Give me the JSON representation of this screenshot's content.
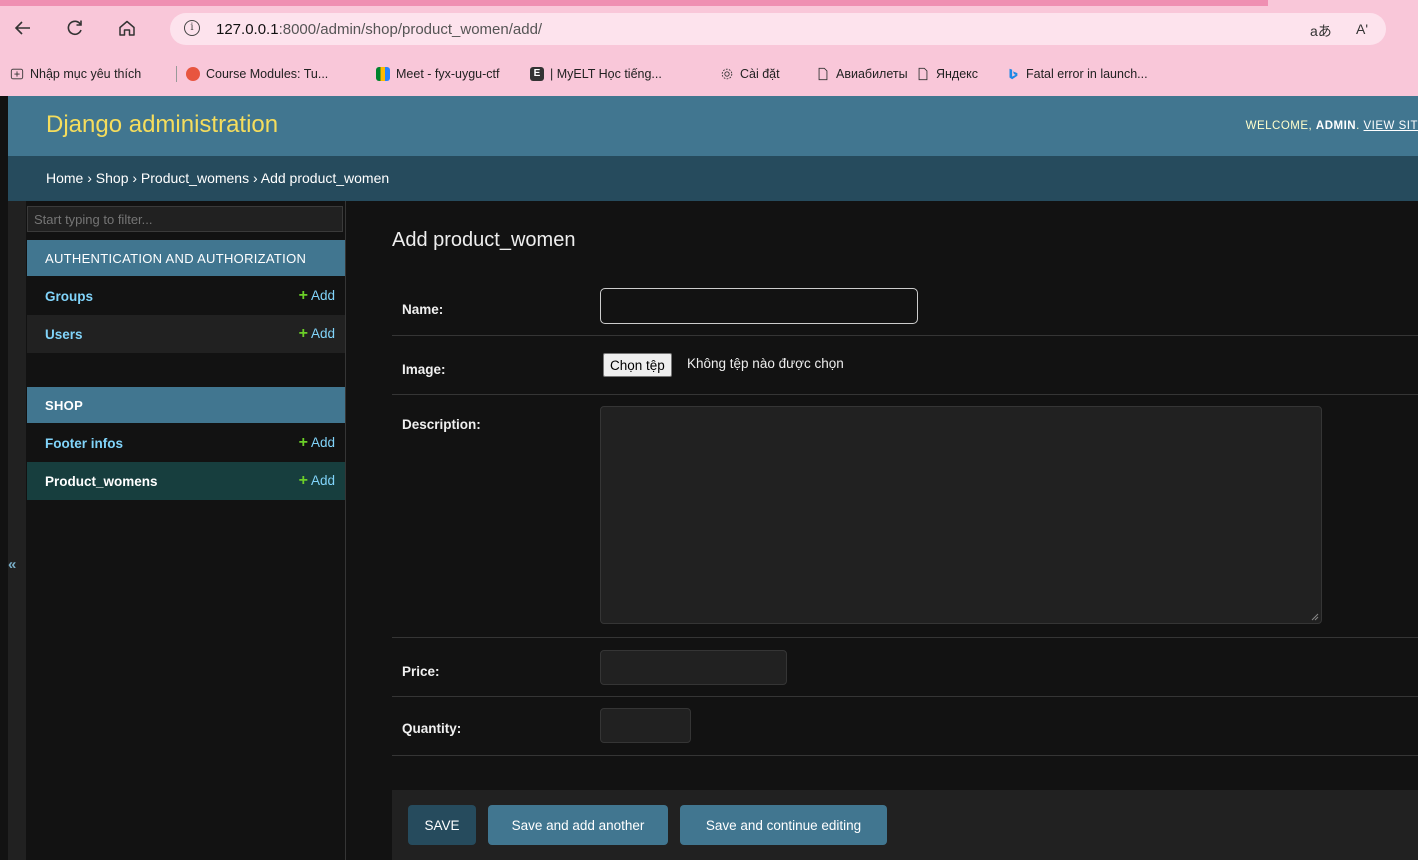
{
  "browser": {
    "address": {
      "host": "127.0.0.1",
      "path": ":8000/admin/shop/product_women/add/"
    },
    "right_icons": [
      "read-aloud-icon",
      "translate-icon"
    ],
    "right_text": {
      "translate": "aあ",
      "read_aloud": "Aʹ"
    },
    "bookmarks": [
      {
        "label": "Nhập mục yêu thích",
        "icon": "bookmark-import-icon"
      },
      {
        "label": "Course Modules: Tu...",
        "icon": "course-modules-icon"
      },
      {
        "label": "Meet - fyx-uygu-ctf",
        "icon": "google-meet-icon"
      },
      {
        "label": "| MyELT Học tiếng...",
        "icon": "myelt-icon"
      },
      {
        "label": "Cài đặt",
        "icon": "settings-gear-icon"
      },
      {
        "label": "Авиабилеты",
        "icon": "page-icon"
      },
      {
        "label": "Яндекс",
        "icon": "page-icon"
      },
      {
        "label": "Fatal error in launch...",
        "icon": "bing-icon"
      }
    ]
  },
  "header": {
    "site_name": "Django administration",
    "welcome": "WELCOME,",
    "user": "ADMIN",
    "view_site": "VIEW SIT"
  },
  "breadcrumbs": "Home › Shop › Product_womens › Add product_women",
  "sidebar": {
    "filter_placeholder": "Start typing to filter...",
    "toggle": "«",
    "modules": [
      {
        "caption": "AUTHENTICATION AND AUTHORIZATION",
        "models": [
          {
            "name": "Groups",
            "add": "Add"
          },
          {
            "name": "Users",
            "add": "Add"
          }
        ]
      },
      {
        "caption": "SHOP",
        "models": [
          {
            "name": "Footer infos",
            "add": "Add"
          },
          {
            "name": "Product_womens",
            "add": "Add",
            "current": true
          }
        ]
      }
    ]
  },
  "content": {
    "title": "Add product_women",
    "fields": {
      "name": {
        "label": "Name:",
        "value": ""
      },
      "image": {
        "label": "Image:",
        "button": "Chọn tệp",
        "status": "Không tệp nào được chọn"
      },
      "description": {
        "label": "Description:",
        "value": ""
      },
      "price": {
        "label": "Price:",
        "value": ""
      },
      "quantity": {
        "label": "Quantity:",
        "value": ""
      }
    },
    "buttons": {
      "save": "SAVE",
      "save_add_another": "Save and add another",
      "save_continue": "Save and continue editing"
    }
  },
  "colors": {
    "header_bg": "#417690",
    "breadcrumbs_bg": "#264b5d",
    "site_name": "#f5dd5d",
    "link": "#81d4fa",
    "add_plus": "#6bcf28",
    "browser_chrome": "#f9c7d9"
  }
}
